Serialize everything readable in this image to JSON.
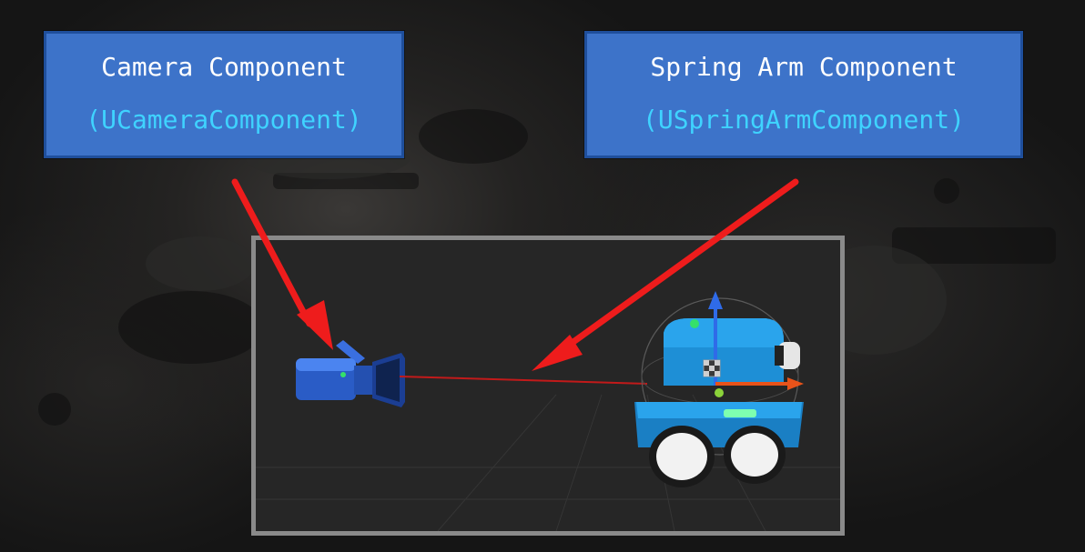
{
  "labels": {
    "camera": {
      "title": "Camera Component",
      "class_name": "(UCameraComponent)"
    },
    "spring_arm": {
      "title": "Spring Arm Component",
      "class_name": "(USpringArmComponent)"
    }
  },
  "colors": {
    "label_fill": "#3d73c9",
    "label_border": "#1f4f9c",
    "label_text": "#ffffff",
    "class_text": "#3fd3ff",
    "pointer_arrows": "#ee1c1c",
    "spring_arm_line": "#c21a1a",
    "viewport_border": "#8a8a8a",
    "viewport_bg": "#262626",
    "robot_body": "#1e8fd6",
    "camera_body": "#2a5cc6"
  },
  "icons": {
    "camera": "video-camera-icon",
    "robot": "robot-pawn-icon",
    "gizmo": "transform-gizmo-icon"
  }
}
